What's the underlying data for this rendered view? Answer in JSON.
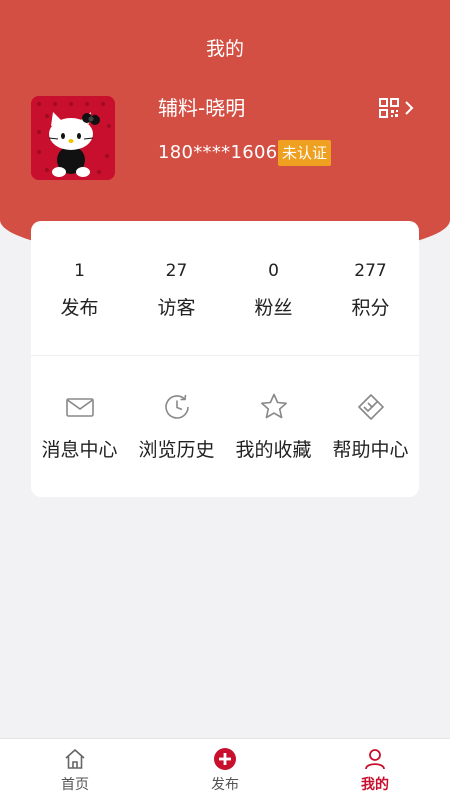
{
  "header": {
    "title": "我的"
  },
  "profile": {
    "name": "辅料-晓明",
    "phone": "180****1606",
    "verify_status": "未认证",
    "avatar_icon": "hello-kitty-avatar",
    "qr_icon": "qr-code-icon"
  },
  "stats": [
    {
      "value": "1",
      "label": "发布"
    },
    {
      "value": "27",
      "label": "访客"
    },
    {
      "value": "0",
      "label": "粉丝"
    },
    {
      "value": "277",
      "label": "积分"
    }
  ],
  "menu": [
    {
      "label": "消息中心",
      "icon": "mail-icon"
    },
    {
      "label": "浏览历史",
      "icon": "history-icon"
    },
    {
      "label": "我的收藏",
      "icon": "star-icon"
    },
    {
      "label": "帮助中心",
      "icon": "handshake-icon"
    }
  ],
  "tabbar": [
    {
      "label": "首页",
      "icon": "home-icon"
    },
    {
      "label": "发布",
      "icon": "add-circle-icon"
    },
    {
      "label": "我的",
      "icon": "user-icon",
      "active": true
    }
  ],
  "colors": {
    "brand": "#d44f43",
    "badge": "#f0a020",
    "active_tab": "#c8102e"
  }
}
